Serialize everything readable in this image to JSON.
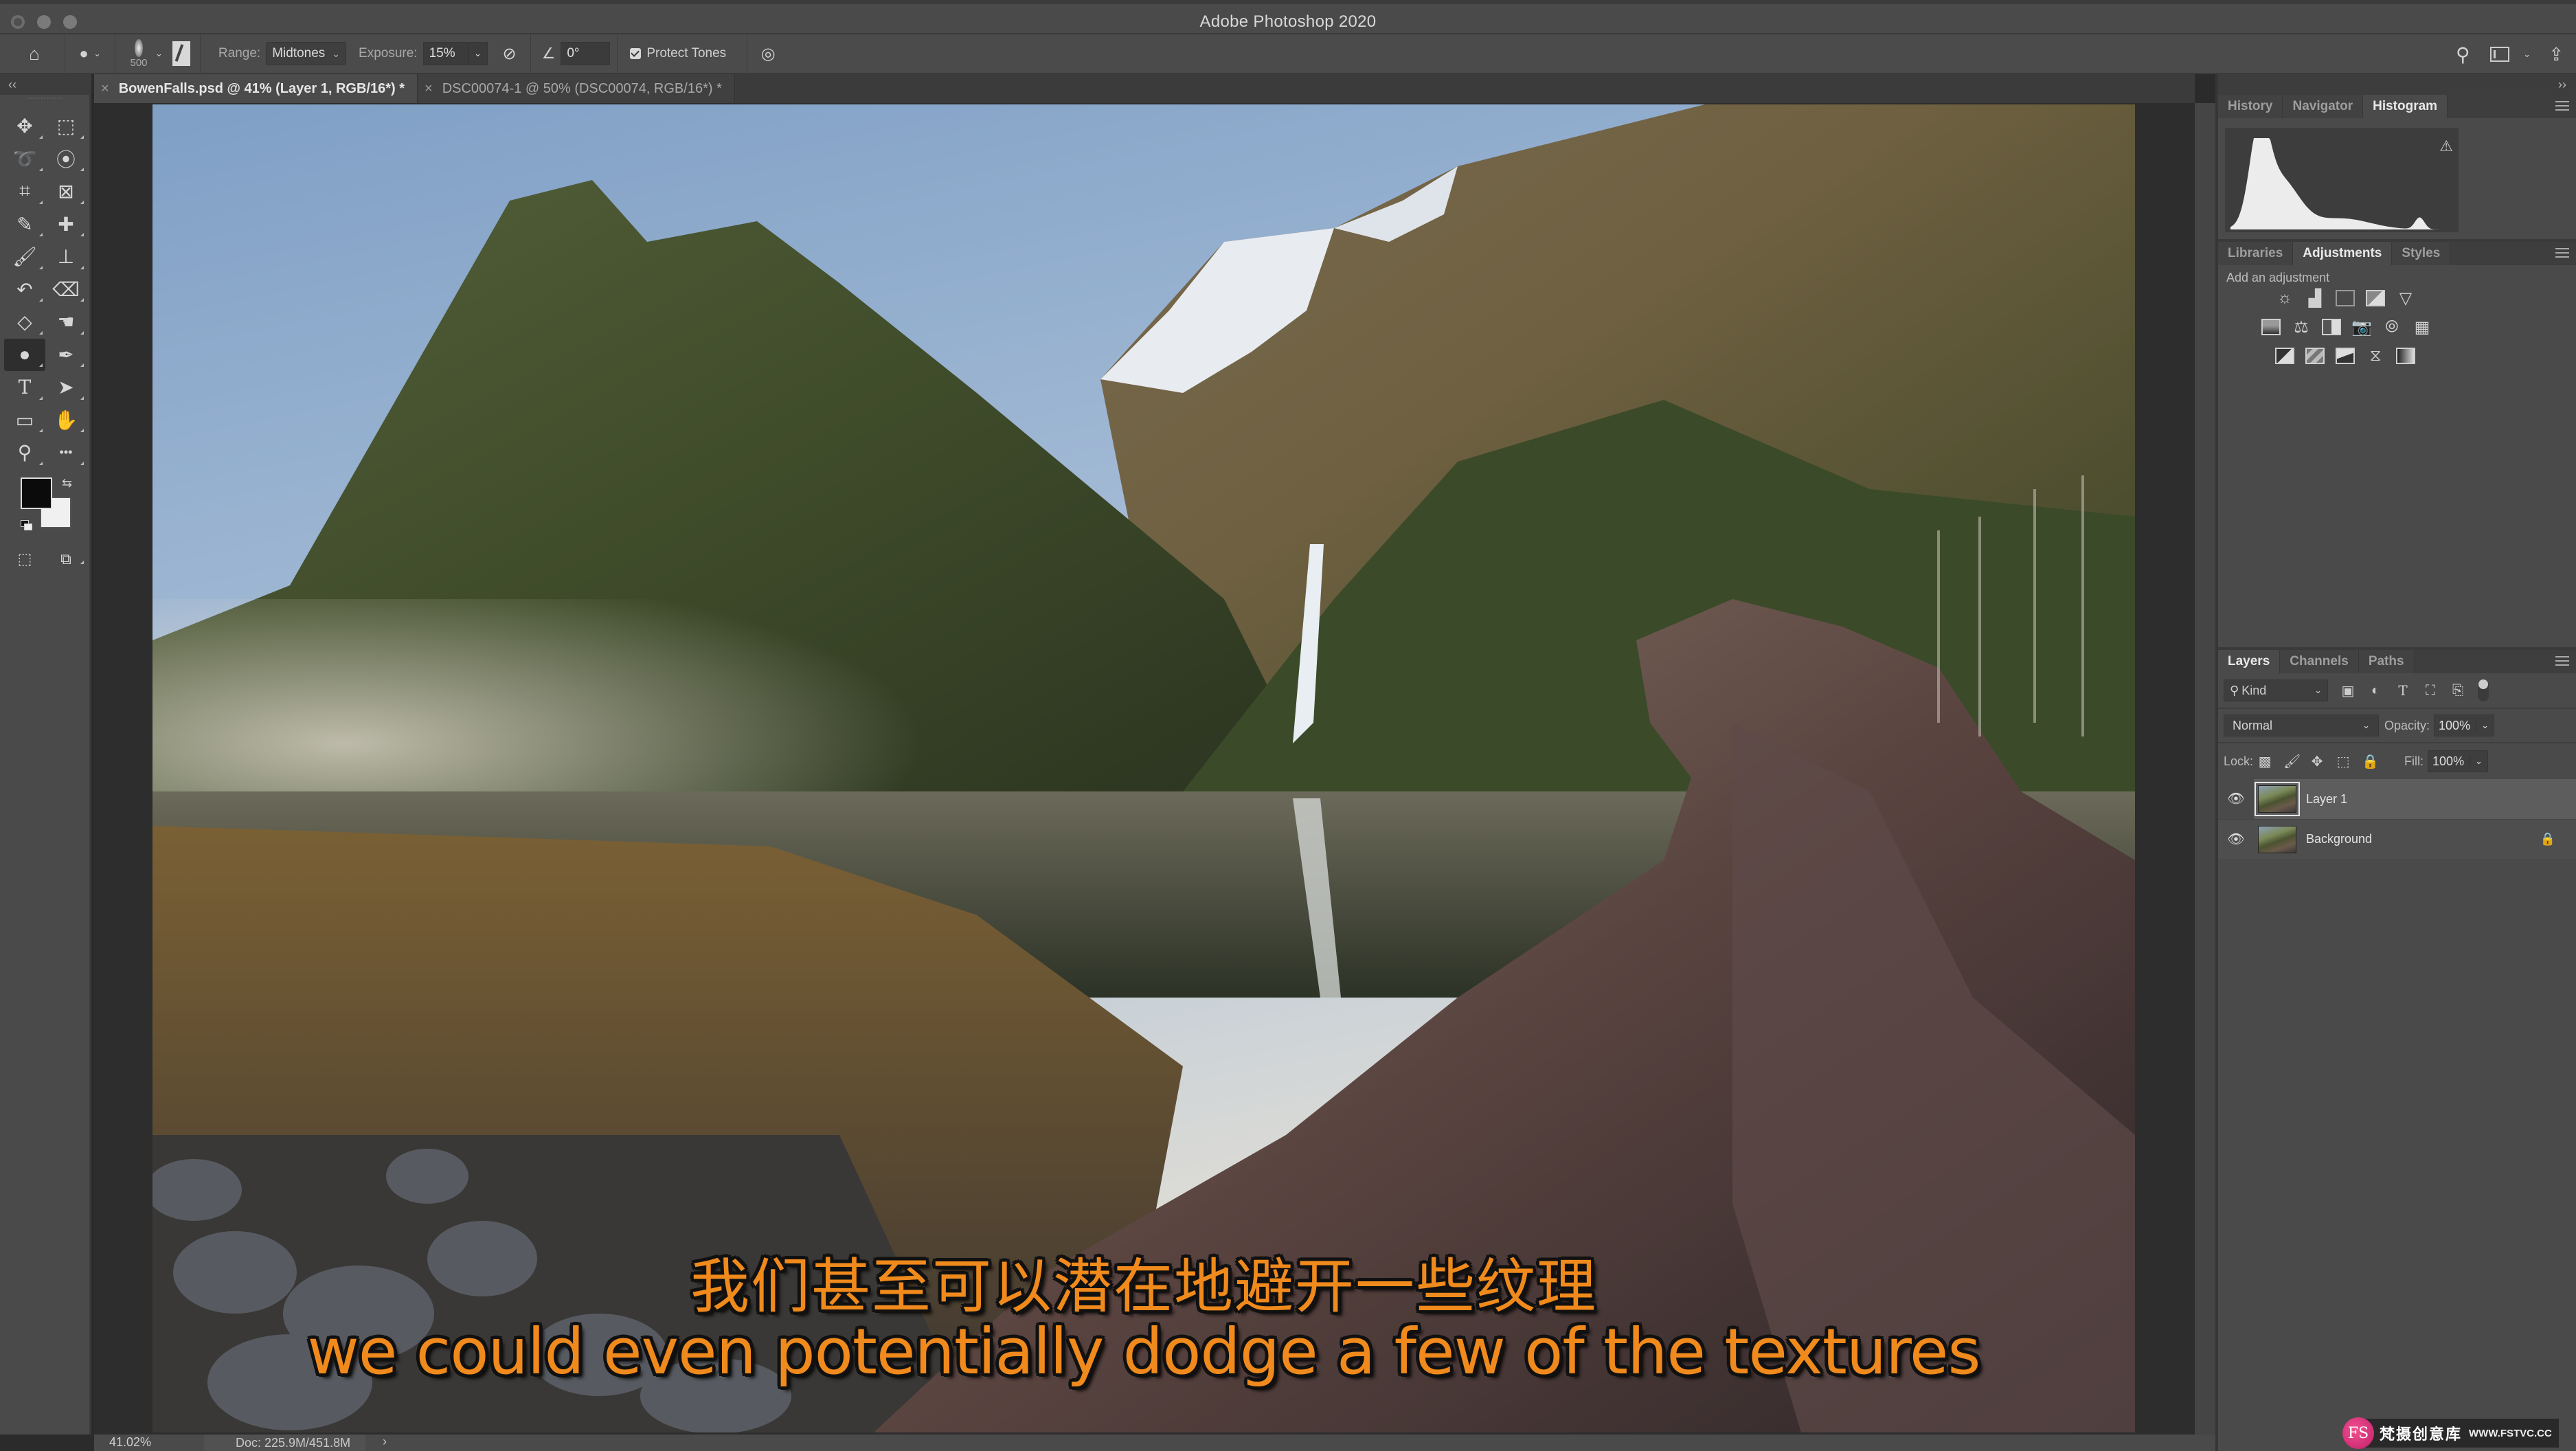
{
  "app": {
    "title": "Adobe Photoshop 2020"
  },
  "options_bar": {
    "tool_icon": "dodge-tool-icon",
    "brush_size": "500",
    "range_label": "Range:",
    "range_value": "Midtones",
    "exposure_label": "Exposure:",
    "exposure_value": "15%",
    "angle_value": "0°",
    "protect_tones_label": "Protect Tones",
    "protect_tones_checked": true
  },
  "document_tabs": [
    {
      "label": "BowenFalls.psd @ 41% (Layer 1, RGB/16*) *",
      "active": true
    },
    {
      "label": "DSC00074-1 @ 50% (DSC00074, RGB/16*) *",
      "active": false
    }
  ],
  "toolbox": {
    "tools": [
      {
        "name": "move-tool",
        "glyph": "✥"
      },
      {
        "name": "marquee-tool",
        "glyph": "⬚"
      },
      {
        "name": "lasso-tool",
        "glyph": "➰"
      },
      {
        "name": "quick-selection-tool",
        "glyph": "⦿"
      },
      {
        "name": "crop-tool",
        "glyph": "⌗"
      },
      {
        "name": "frame-tool",
        "glyph": "⊠"
      },
      {
        "name": "eyedropper-tool",
        "glyph": "✎"
      },
      {
        "name": "healing-brush-tool",
        "glyph": "✚"
      },
      {
        "name": "brush-tool",
        "glyph": "🖌"
      },
      {
        "name": "clone-stamp-tool",
        "glyph": "⊥"
      },
      {
        "name": "history-brush-tool",
        "glyph": "↶"
      },
      {
        "name": "eraser-tool",
        "glyph": "⌫"
      },
      {
        "name": "paint-bucket-tool",
        "glyph": "◇"
      },
      {
        "name": "smudge-tool",
        "glyph": "☚"
      },
      {
        "name": "dodge-tool",
        "glyph": "●"
      },
      {
        "name": "pen-tool",
        "glyph": "✒"
      },
      {
        "name": "type-tool",
        "glyph": "T"
      },
      {
        "name": "path-selection-tool",
        "glyph": "➤"
      },
      {
        "name": "rectangle-tool",
        "glyph": "▭"
      },
      {
        "name": "hand-tool",
        "glyph": "✋"
      },
      {
        "name": "zoom-tool",
        "glyph": "⚲"
      },
      {
        "name": "edit-toolbar",
        "glyph": "•••"
      }
    ],
    "active_tool": "dodge-tool",
    "foreground_color": "#0b0b0b",
    "background_color": "#f0f0f0"
  },
  "canvas": {
    "subtitle_zh": "我们甚至可以潜在地避开一些纹理",
    "subtitle_en": "we could even potentially dodge a few of the textures",
    "subtitle_color": "#f08a1c"
  },
  "status_bar": {
    "zoom": "41.02%",
    "doc_info": "Doc: 225.9M/451.8M",
    "arrow": "›"
  },
  "panels": {
    "top_group": {
      "tabs": [
        "History",
        "Navigator",
        "Histogram"
      ],
      "active": "Histogram"
    },
    "histogram": {
      "warning_icon": "cache-warning-icon"
    },
    "mid_group": {
      "tabs": [
        "Libraries",
        "Adjustments",
        "Styles"
      ],
      "active": "Adjustments",
      "hint": "Add an adjustment",
      "rows": [
        [
          "brightness-contrast",
          "levels",
          "curves",
          "exposure",
          "vibrance"
        ],
        [
          "hue-saturation",
          "color-balance",
          "black-white",
          "photo-filter",
          "channel-mixer",
          "color-lookup"
        ],
        [
          "invert",
          "posterize",
          "threshold",
          "selective-color",
          "gradient-map"
        ]
      ]
    },
    "layers_group": {
      "tabs": [
        "Layers",
        "Channels",
        "Paths"
      ],
      "active": "Layers",
      "filter_kind": "Kind",
      "blend_mode": "Normal",
      "opacity_label": "Opacity:",
      "opacity": "100%",
      "lock_label": "Lock:",
      "fill_label": "Fill:",
      "fill": "100%",
      "layers": [
        {
          "name": "Layer 1",
          "visible": true,
          "selected": true,
          "locked": false
        },
        {
          "name": "Background",
          "visible": true,
          "selected": false,
          "locked": true
        }
      ]
    }
  },
  "watermark": {
    "logo": "FS",
    "name_cn": "梵摄创意库",
    "url": "WWW.FSTVC.CC"
  }
}
